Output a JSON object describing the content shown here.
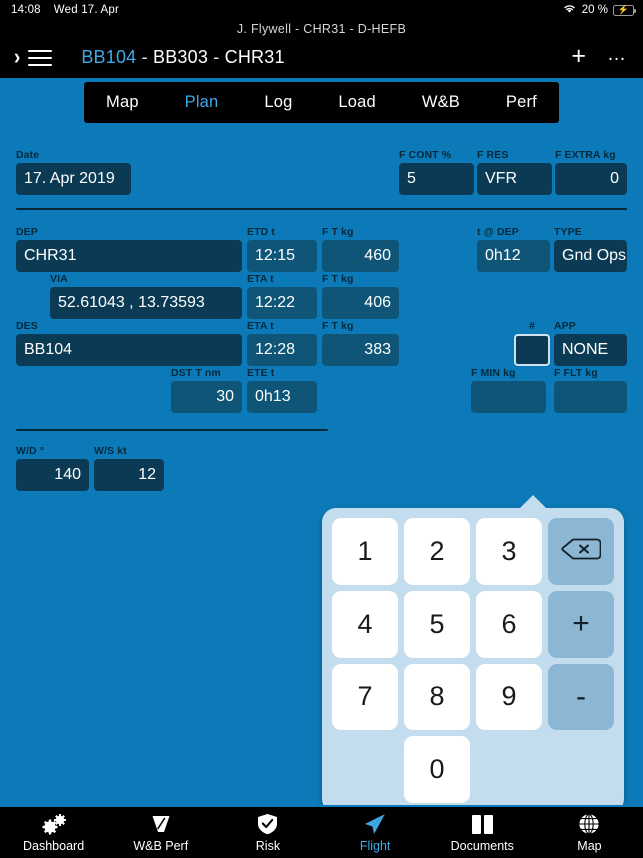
{
  "statusbar": {
    "time": "14:08",
    "date": "Wed 17. Apr",
    "battery_percent": "20 %",
    "wifi_icon": "wifi-icon",
    "battery_icon": "battery-charging-icon"
  },
  "header": {
    "subtitle": "J. Flywell  -  CHR31  -  D-HEFB",
    "route_leg1": "BB104",
    "route_sep1": "-",
    "route_leg2": "BB303",
    "route_sep2": "-",
    "route_leg3": "CHR31",
    "expand_icon": "chevron-right-icon",
    "menu_icon": "hamburger-menu-icon",
    "add_label": "+",
    "more_label": "…"
  },
  "tabs": [
    {
      "label": "Map",
      "active": false
    },
    {
      "label": "Plan",
      "active": true
    },
    {
      "label": "Log",
      "active": false
    },
    {
      "label": "Load",
      "active": false
    },
    {
      "label": "W&B",
      "active": false
    },
    {
      "label": "Perf",
      "active": false
    }
  ],
  "form": {
    "date": {
      "label": "Date",
      "value": "17. Apr 2019"
    },
    "f_cont": {
      "label": "F CONT %",
      "value": "5"
    },
    "f_res": {
      "label": "F RES",
      "value": "VFR"
    },
    "f_extra": {
      "label": "F EXTRA kg",
      "value": "0"
    },
    "dep": {
      "label": "DEP",
      "value": "CHR31"
    },
    "etd": {
      "label": "ETD t",
      "value": "12:15"
    },
    "ft_dep": {
      "label": "F T kg",
      "value": "460"
    },
    "t_at_dep": {
      "label": "t @ DEP",
      "value": "0h12"
    },
    "type": {
      "label": "TYPE",
      "value": "Gnd Ops"
    },
    "via": {
      "label": "VIA",
      "value": "52.61043 , 13.73593"
    },
    "eta_via": {
      "label": "ETA t",
      "value": "12:22"
    },
    "ft_via": {
      "label": "F T kg",
      "value": "406"
    },
    "des": {
      "label": "DES",
      "value": "BB104"
    },
    "eta_des": {
      "label": "ETA t",
      "value": "12:28"
    },
    "ft_des": {
      "label": "F T kg",
      "value": "383"
    },
    "hash": {
      "label": "#",
      "value": ""
    },
    "app": {
      "label": "APP",
      "value": "NONE"
    },
    "dst": {
      "label": "DST T nm",
      "value": "30"
    },
    "ete": {
      "label": "ETE t",
      "value": "0h13"
    },
    "f_min": {
      "label": "F MIN kg",
      "value": ""
    },
    "f_flt": {
      "label": "F FLT kg",
      "value": ""
    },
    "wd": {
      "label": "W/D °",
      "value": "140"
    },
    "ws": {
      "label": "W/S kt",
      "value": "12"
    }
  },
  "keypad": {
    "keys": [
      "1",
      "2",
      "3",
      "backspace",
      "4",
      "5",
      "6",
      "+",
      "7",
      "8",
      "9",
      "-",
      "",
      "0",
      "",
      ""
    ],
    "backspace_icon": "backspace-icon"
  },
  "bottom_nav": [
    {
      "label": "Dashboard",
      "icon": "gears-icon",
      "active": false
    },
    {
      "label": "W&B Perf",
      "icon": "balance-gauge-icon",
      "active": false
    },
    {
      "label": "Risk",
      "icon": "shield-check-icon",
      "active": false
    },
    {
      "label": "Flight",
      "icon": "paper-plane-icon",
      "active": true
    },
    {
      "label": "Documents",
      "icon": "book-icon",
      "active": false
    },
    {
      "label": "Map",
      "icon": "globe-icon",
      "active": false
    }
  ],
  "colors": {
    "page_bg": "#0c7ab8",
    "field_dark": "#0b3b54",
    "field_light": "#0e5578",
    "accent": "#3fa9e8",
    "keypad_bg": "#c3dcee",
    "keypad_op": "#8cb7d4",
    "battery_green": "#2ecc40"
  }
}
